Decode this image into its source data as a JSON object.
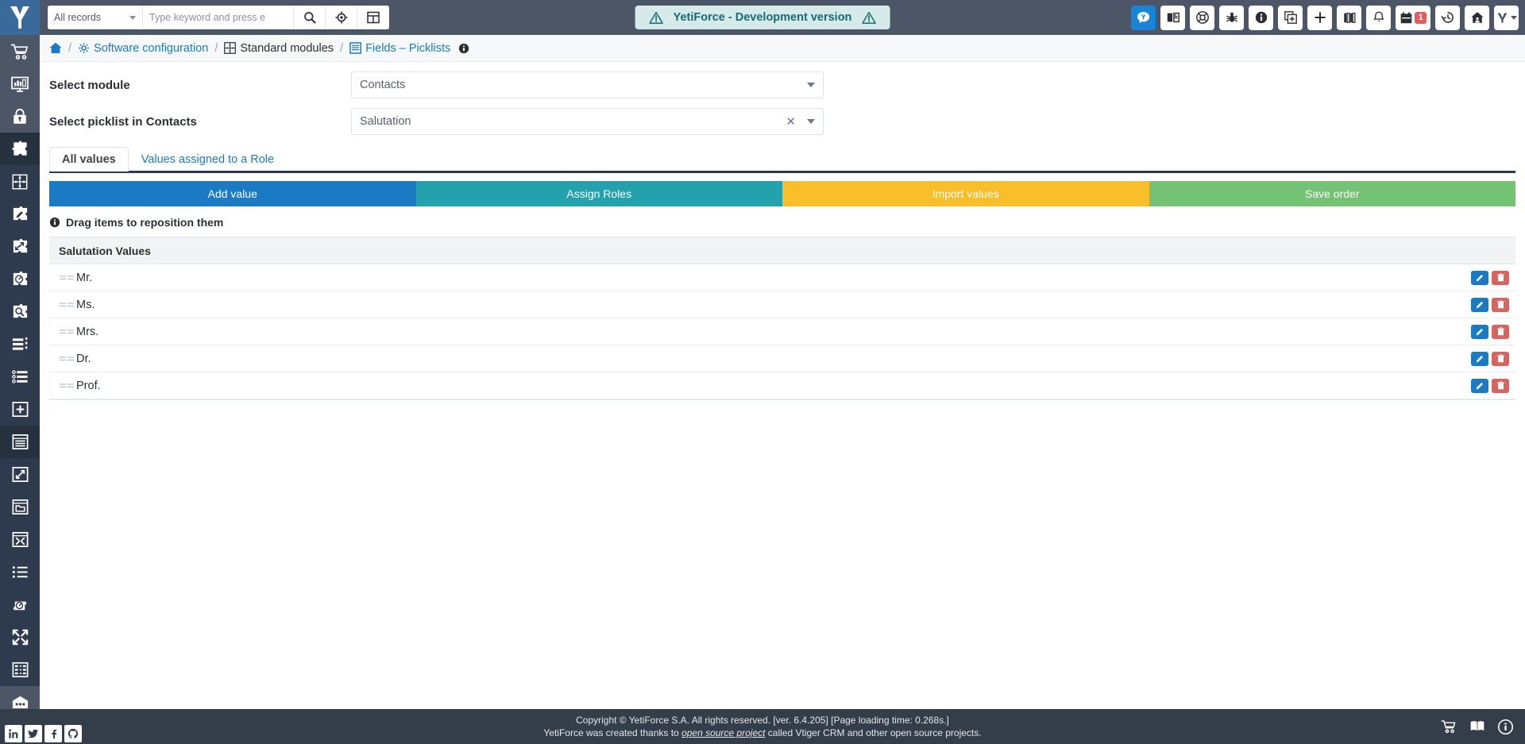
{
  "header": {
    "logo_icon": "yetiforce-logo-icon",
    "records_filter": {
      "label": "All records",
      "icon": "chevron-down-icon"
    },
    "search": {
      "value": "",
      "placeholder": "Type keyword and press e"
    },
    "search_button_icon": "search-icon",
    "location_button_icon": "crosshair-icon",
    "grid_button_icon": "grid-icon",
    "dev_banner": {
      "text": "YetiForce - Development version",
      "left_icon": "warning-triangle-icon",
      "right_icon": "warning-triangle-icon",
      "bg_color": "#d6eaea",
      "text_color": "#176b72"
    },
    "icons": [
      {
        "name": "chat-icon",
        "label": "Chat",
        "active": true
      },
      {
        "name": "knowledge-base-icon",
        "label": "Knowledge base",
        "active": false
      },
      {
        "name": "support-lifebuoy-icon",
        "label": "Support",
        "active": false
      },
      {
        "name": "bug-icon",
        "label": "Report bug",
        "active": false
      },
      {
        "name": "info-circle-icon",
        "label": "Information",
        "active": false
      },
      {
        "name": "copy-add-icon",
        "label": "Quick create",
        "active": false
      },
      {
        "name": "plus-icon",
        "label": "Add",
        "active": false
      },
      {
        "name": "library-books-icon",
        "label": "Library",
        "active": false
      },
      {
        "name": "bell-icon",
        "label": "Notifications",
        "active": false
      },
      {
        "name": "calendar-icon",
        "label": "Calendar",
        "active": false,
        "badge": "1"
      },
      {
        "name": "history-clock-icon",
        "label": "History",
        "active": false
      },
      {
        "name": "home-user-icon",
        "label": "Home",
        "active": false
      },
      {
        "name": "user-menu-icon",
        "label": "User menu",
        "active": false
      }
    ]
  },
  "sidebar": {
    "items": [
      {
        "name": "sidebar-item-cart",
        "icon": "shopping-cart-icon",
        "group": "light",
        "active": false
      },
      {
        "name": "sidebar-item-dashboard",
        "icon": "dashboard-monitor-icon",
        "group": "light",
        "active": false
      },
      {
        "name": "sidebar-item-security",
        "icon": "lock-icon",
        "group": "light",
        "active": false
      },
      {
        "name": "sidebar-item-modules",
        "icon": "puzzle-icon",
        "group": "light",
        "active": true
      },
      {
        "name": "sidebar-item-integration",
        "icon": "puzzle-grid-icon",
        "group": "dark",
        "active": false
      },
      {
        "name": "sidebar-item-edit-module",
        "icon": "puzzle-pencil-icon",
        "group": "dark",
        "active": false
      },
      {
        "name": "sidebar-item-transfer",
        "icon": "puzzle-arrows-icon",
        "group": "dark",
        "active": false
      },
      {
        "name": "sidebar-item-gauge",
        "icon": "puzzle-gauge-icon",
        "group": "dark",
        "active": false
      },
      {
        "name": "sidebar-item-search-module",
        "icon": "puzzle-search-icon",
        "group": "dark",
        "active": false
      },
      {
        "name": "sidebar-item-fields",
        "icon": "list-settings-icon",
        "group": "dark",
        "active": false
      },
      {
        "name": "sidebar-item-picklists",
        "icon": "ordered-list-icon",
        "group": "dark",
        "active": false
      },
      {
        "name": "sidebar-item-add-window",
        "icon": "window-plus-icon",
        "group": "dark",
        "active": false
      },
      {
        "name": "sidebar-item-layout",
        "icon": "window-lines-icon",
        "group": "dark",
        "active": true
      },
      {
        "name": "sidebar-item-resize",
        "icon": "window-arrows-icon",
        "group": "dark",
        "active": false
      },
      {
        "name": "sidebar-item-folder",
        "icon": "window-folder-icon",
        "group": "dark",
        "active": false
      },
      {
        "name": "sidebar-item-collapse-window",
        "icon": "window-collapse-icon",
        "group": "dark",
        "active": false
      },
      {
        "name": "sidebar-item-bullet-list",
        "icon": "bullet-list-icon",
        "group": "dark",
        "active": false
      },
      {
        "name": "sidebar-item-cloud-gauge",
        "icon": "cloud-gauge-icon",
        "group": "dark",
        "active": false
      },
      {
        "name": "sidebar-item-compress",
        "icon": "compress-arrows-icon",
        "group": "dark",
        "active": false
      },
      {
        "name": "sidebar-item-table-config",
        "icon": "table-config-icon",
        "group": "dark",
        "active": false
      },
      {
        "name": "sidebar-item-warehouse",
        "icon": "warehouse-icon",
        "group": "light",
        "active": false
      }
    ]
  },
  "breadcrumb": {
    "home_icon": "home-icon",
    "items": [
      {
        "label": "Software configuration",
        "icon": "gear-icon",
        "link": true
      },
      {
        "label": "Standard modules",
        "icon": "modules-icon",
        "link": false
      },
      {
        "label": "Fields – Picklists",
        "icon": "picklist-icon",
        "link": true
      }
    ],
    "info_icon": "info-circle-icon",
    "separator": "/"
  },
  "form": {
    "module_label": "Select module",
    "module_value": "Contacts",
    "module_caret_icon": "chevron-down-icon",
    "picklist_label": "Select picklist in Contacts",
    "picklist_value": "Salutation",
    "picklist_clear_icon": "close-x-icon",
    "picklist_caret_icon": "chevron-down-icon"
  },
  "tabs": [
    {
      "label": "All values",
      "active": true
    },
    {
      "label": "Values assigned to a Role",
      "active": false
    }
  ],
  "actions": [
    {
      "label": "Add value",
      "color": "#1a7bc4"
    },
    {
      "label": "Assign Roles",
      "color": "#23a1ad"
    },
    {
      "label": "Import values",
      "color": "#f9bf2b"
    },
    {
      "label": "Save order",
      "color": "#74c274"
    }
  ],
  "drag_hint": {
    "icon": "info-circle-icon",
    "text": "Drag items to reposition them"
  },
  "list": {
    "header": "Salutation Values",
    "drag_handle_icon": "drag-grip-icon",
    "edit_icon": "pencil-icon",
    "delete_icon": "trash-icon",
    "rows": [
      {
        "value": "Mr."
      },
      {
        "value": "Ms."
      },
      {
        "value": "Mrs."
      },
      {
        "value": "Dr."
      },
      {
        "value": "Prof."
      }
    ]
  },
  "footer": {
    "social": [
      {
        "name": "linkedin-icon",
        "glyph": "in"
      },
      {
        "name": "twitter-icon",
        "glyph": "t"
      },
      {
        "name": "facebook-icon",
        "glyph": "f"
      },
      {
        "name": "github-icon",
        "glyph": "g"
      }
    ],
    "line1": "Copyright © YetiForce S.A. All rights reserved. [ver. 6.4.205] [Page loading time: 0.268s.]",
    "line2_pre": "YetiForce was created thanks to ",
    "line2_link": "open source project",
    "line2_post": " called Vtiger CRM and other open source projects.",
    "icons": [
      {
        "name": "shopping-cart-icon"
      },
      {
        "name": "book-icon"
      },
      {
        "name": "info-circle-icon"
      }
    ]
  }
}
